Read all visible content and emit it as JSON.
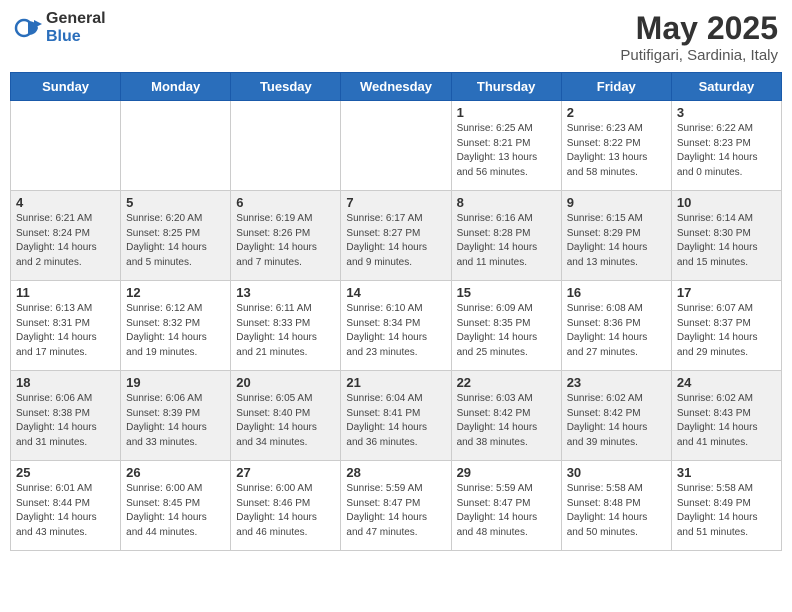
{
  "header": {
    "logo_general": "General",
    "logo_blue": "Blue",
    "month_title": "May 2025",
    "subtitle": "Putifigari, Sardinia, Italy"
  },
  "weekdays": [
    "Sunday",
    "Monday",
    "Tuesday",
    "Wednesday",
    "Thursday",
    "Friday",
    "Saturday"
  ],
  "rows": [
    [
      {
        "day": "",
        "info": ""
      },
      {
        "day": "",
        "info": ""
      },
      {
        "day": "",
        "info": ""
      },
      {
        "day": "",
        "info": ""
      },
      {
        "day": "1",
        "info": "Sunrise: 6:25 AM\nSunset: 8:21 PM\nDaylight: 13 hours\nand 56 minutes."
      },
      {
        "day": "2",
        "info": "Sunrise: 6:23 AM\nSunset: 8:22 PM\nDaylight: 13 hours\nand 58 minutes."
      },
      {
        "day": "3",
        "info": "Sunrise: 6:22 AM\nSunset: 8:23 PM\nDaylight: 14 hours\nand 0 minutes."
      }
    ],
    [
      {
        "day": "4",
        "info": "Sunrise: 6:21 AM\nSunset: 8:24 PM\nDaylight: 14 hours\nand 2 minutes."
      },
      {
        "day": "5",
        "info": "Sunrise: 6:20 AM\nSunset: 8:25 PM\nDaylight: 14 hours\nand 5 minutes."
      },
      {
        "day": "6",
        "info": "Sunrise: 6:19 AM\nSunset: 8:26 PM\nDaylight: 14 hours\nand 7 minutes."
      },
      {
        "day": "7",
        "info": "Sunrise: 6:17 AM\nSunset: 8:27 PM\nDaylight: 14 hours\nand 9 minutes."
      },
      {
        "day": "8",
        "info": "Sunrise: 6:16 AM\nSunset: 8:28 PM\nDaylight: 14 hours\nand 11 minutes."
      },
      {
        "day": "9",
        "info": "Sunrise: 6:15 AM\nSunset: 8:29 PM\nDaylight: 14 hours\nand 13 minutes."
      },
      {
        "day": "10",
        "info": "Sunrise: 6:14 AM\nSunset: 8:30 PM\nDaylight: 14 hours\nand 15 minutes."
      }
    ],
    [
      {
        "day": "11",
        "info": "Sunrise: 6:13 AM\nSunset: 8:31 PM\nDaylight: 14 hours\nand 17 minutes."
      },
      {
        "day": "12",
        "info": "Sunrise: 6:12 AM\nSunset: 8:32 PM\nDaylight: 14 hours\nand 19 minutes."
      },
      {
        "day": "13",
        "info": "Sunrise: 6:11 AM\nSunset: 8:33 PM\nDaylight: 14 hours\nand 21 minutes."
      },
      {
        "day": "14",
        "info": "Sunrise: 6:10 AM\nSunset: 8:34 PM\nDaylight: 14 hours\nand 23 minutes."
      },
      {
        "day": "15",
        "info": "Sunrise: 6:09 AM\nSunset: 8:35 PM\nDaylight: 14 hours\nand 25 minutes."
      },
      {
        "day": "16",
        "info": "Sunrise: 6:08 AM\nSunset: 8:36 PM\nDaylight: 14 hours\nand 27 minutes."
      },
      {
        "day": "17",
        "info": "Sunrise: 6:07 AM\nSunset: 8:37 PM\nDaylight: 14 hours\nand 29 minutes."
      }
    ],
    [
      {
        "day": "18",
        "info": "Sunrise: 6:06 AM\nSunset: 8:38 PM\nDaylight: 14 hours\nand 31 minutes."
      },
      {
        "day": "19",
        "info": "Sunrise: 6:06 AM\nSunset: 8:39 PM\nDaylight: 14 hours\nand 33 minutes."
      },
      {
        "day": "20",
        "info": "Sunrise: 6:05 AM\nSunset: 8:40 PM\nDaylight: 14 hours\nand 34 minutes."
      },
      {
        "day": "21",
        "info": "Sunrise: 6:04 AM\nSunset: 8:41 PM\nDaylight: 14 hours\nand 36 minutes."
      },
      {
        "day": "22",
        "info": "Sunrise: 6:03 AM\nSunset: 8:42 PM\nDaylight: 14 hours\nand 38 minutes."
      },
      {
        "day": "23",
        "info": "Sunrise: 6:02 AM\nSunset: 8:42 PM\nDaylight: 14 hours\nand 39 minutes."
      },
      {
        "day": "24",
        "info": "Sunrise: 6:02 AM\nSunset: 8:43 PM\nDaylight: 14 hours\nand 41 minutes."
      }
    ],
    [
      {
        "day": "25",
        "info": "Sunrise: 6:01 AM\nSunset: 8:44 PM\nDaylight: 14 hours\nand 43 minutes."
      },
      {
        "day": "26",
        "info": "Sunrise: 6:00 AM\nSunset: 8:45 PM\nDaylight: 14 hours\nand 44 minutes."
      },
      {
        "day": "27",
        "info": "Sunrise: 6:00 AM\nSunset: 8:46 PM\nDaylight: 14 hours\nand 46 minutes."
      },
      {
        "day": "28",
        "info": "Sunrise: 5:59 AM\nSunset: 8:47 PM\nDaylight: 14 hours\nand 47 minutes."
      },
      {
        "day": "29",
        "info": "Sunrise: 5:59 AM\nSunset: 8:47 PM\nDaylight: 14 hours\nand 48 minutes."
      },
      {
        "day": "30",
        "info": "Sunrise: 5:58 AM\nSunset: 8:48 PM\nDaylight: 14 hours\nand 50 minutes."
      },
      {
        "day": "31",
        "info": "Sunrise: 5:58 AM\nSunset: 8:49 PM\nDaylight: 14 hours\nand 51 minutes."
      }
    ]
  ]
}
